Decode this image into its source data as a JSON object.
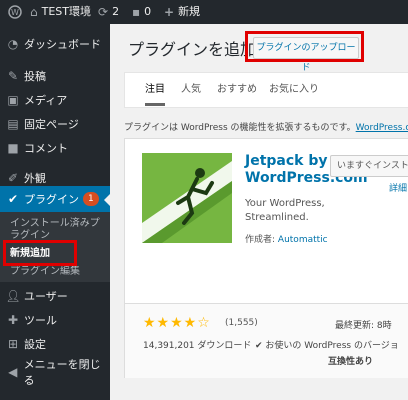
{
  "adminbar": {
    "site_name": "TEST環境",
    "updates_count": "2",
    "comments_count": "0",
    "new_label": "新規"
  },
  "sidebar": {
    "items": [
      {
        "label": "ダッシュボード",
        "icon": "dashboard-icon"
      },
      {
        "label": "投稿",
        "icon": "pin-icon"
      },
      {
        "label": "メディア",
        "icon": "media-icon"
      },
      {
        "label": "固定ページ",
        "icon": "page-icon"
      },
      {
        "label": "コメント",
        "icon": "comment-icon"
      },
      {
        "label": "外観",
        "icon": "appearance-icon"
      },
      {
        "label": "プラグイン",
        "icon": "plugin-icon",
        "badge": "1"
      },
      {
        "label": "ユーザー",
        "icon": "user-icon"
      },
      {
        "label": "ツール",
        "icon": "tool-icon"
      },
      {
        "label": "設定",
        "icon": "settings-icon"
      },
      {
        "label": "メニューを閉じる",
        "icon": "collapse-icon"
      }
    ],
    "submenu": [
      "インストール済みプラグイン",
      "新規追加",
      "プラグイン編集"
    ]
  },
  "main": {
    "title": "プラグインを追加",
    "upload_button": "プラグインのアップロード",
    "tabs": [
      "注目",
      "人気",
      "おすすめ",
      "お気に入り"
    ],
    "description": "プラグインは WordPress の機能性を拡張するものです。",
    "description_link": "WordPress.org"
  },
  "plugin_card": {
    "name": "Jetpack by WordPress.com",
    "install_button": "いますぐインストール",
    "details_link": "詳細",
    "description": "Your WordPress, Streamlined.",
    "author_label": "作成者:",
    "author": "Automattic",
    "rating_stars": "★★★★☆",
    "rating_count": "(1,555)",
    "downloads": "14,391,201 ダウンロード",
    "last_updated": "最終更新: 8時",
    "compat_text": "お使いの WordPress のバージョ",
    "compat_text2": "互換性あり"
  },
  "colors": {
    "admin_dark": "#23282d",
    "accent_blue": "#0073aa",
    "highlight_red": "#e00000",
    "jetpack_green": "#76b641"
  }
}
